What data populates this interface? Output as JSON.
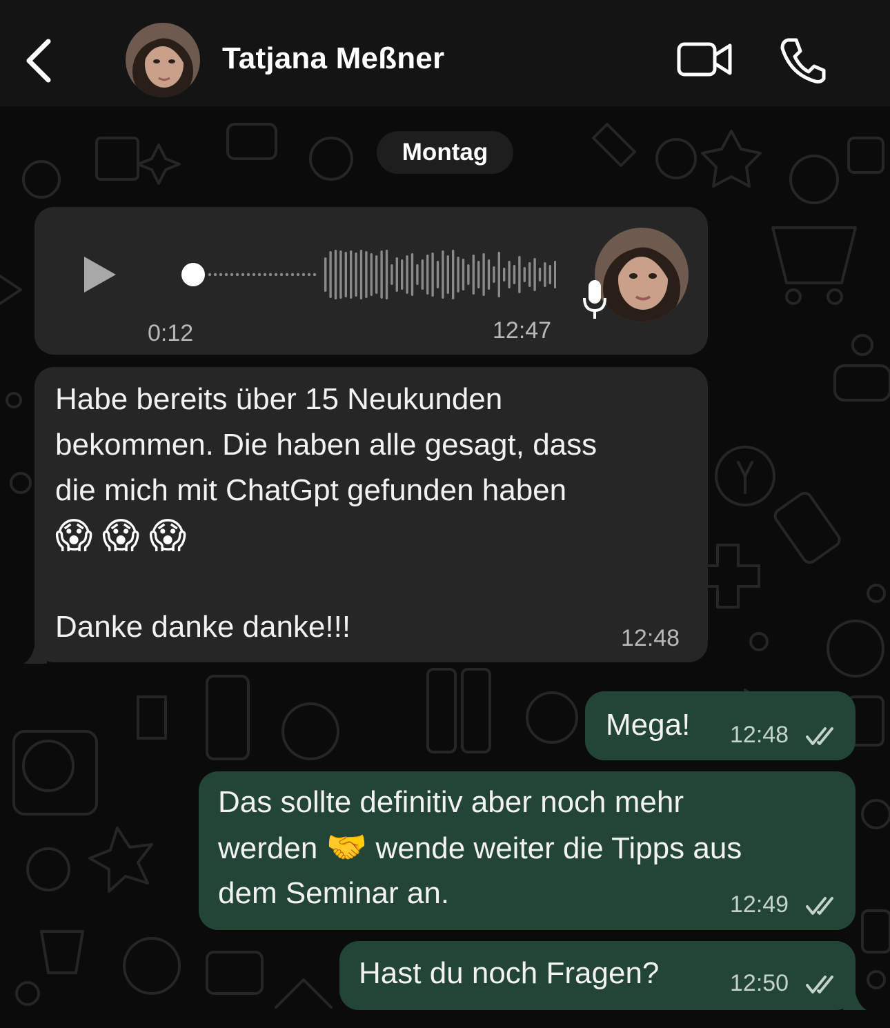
{
  "header": {
    "contact_name": "Tatjana Meßner",
    "back_icon": "chevron-left-icon",
    "video_icon": "video-camera-icon",
    "call_icon": "phone-icon"
  },
  "day_separator": "Montag",
  "voice_message": {
    "duration": "0:12",
    "time": "12:47",
    "progress": 0
  },
  "messages": [
    {
      "direction": "incoming",
      "lines": [
        "Habe bereits über 15 Neukunden",
        "bekommen. Die haben alle gesagt, dass",
        "die mich mit ChatGpt gefunden haben"
      ],
      "emojis": [
        "😱",
        "😱",
        "😱"
      ],
      "closing": "Danke danke danke!!!",
      "time": "12:48"
    },
    {
      "direction": "outgoing",
      "text": "Mega!",
      "time": "12:48",
      "status": "read"
    },
    {
      "direction": "outgoing",
      "line1": "Das sollte definitiv aber noch mehr",
      "line2_before": "werden",
      "emoji": "🤝",
      "line2_after": "wende weiter die Tipps aus",
      "line3": "dem Seminar an.",
      "time": "12:49",
      "status": "read"
    },
    {
      "direction": "outgoing",
      "text": "Hast du noch Fragen?",
      "time": "12:50",
      "status": "read"
    }
  ],
  "colors": {
    "background": "#0b0b0b",
    "header": "#141414",
    "incoming_bubble": "#262626",
    "outgoing_bubble": "#224535",
    "timestamp": "#b8b8b8"
  }
}
